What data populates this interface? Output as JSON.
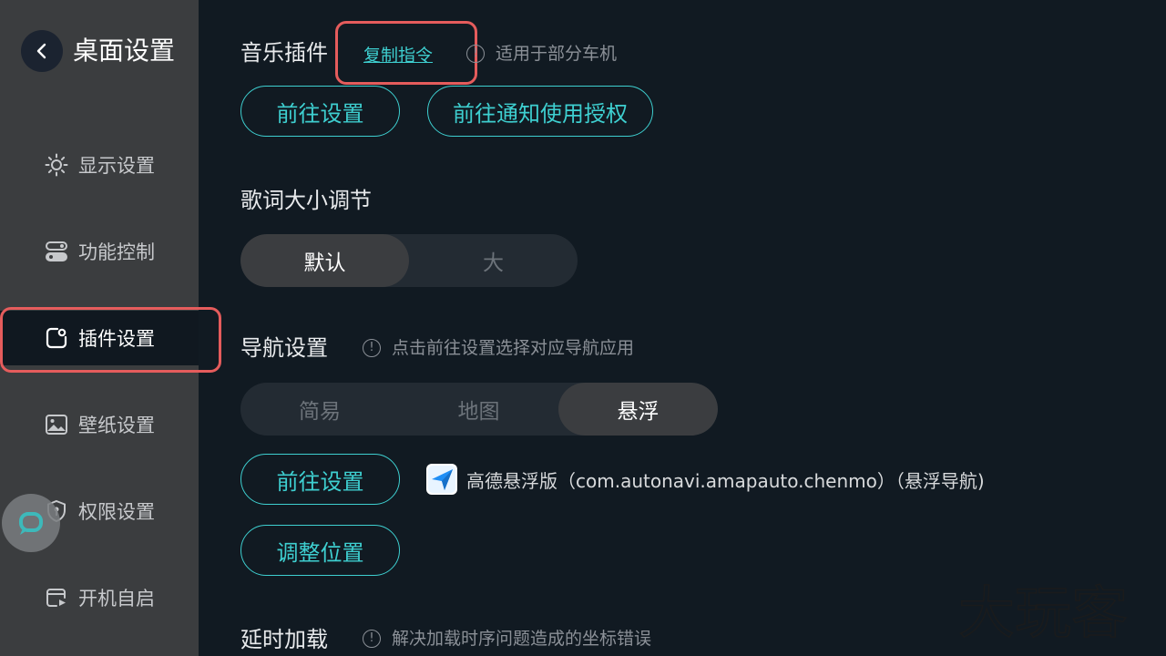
{
  "sidebar": {
    "title": "桌面设置",
    "items": [
      {
        "label": "显示设置",
        "icon": "sun-icon"
      },
      {
        "label": "功能控制",
        "icon": "toggle-icon"
      },
      {
        "label": "插件设置",
        "icon": "plugin-icon"
      },
      {
        "label": "壁纸设置",
        "icon": "image-icon"
      },
      {
        "label": "权限设置",
        "icon": "shield-icon"
      },
      {
        "label": "开机自启",
        "icon": "startup-icon"
      }
    ],
    "active_index": 2
  },
  "music_plugin": {
    "title": "音乐插件",
    "copy_link": "复制指令",
    "hint": "适用于部分车机",
    "buttons": [
      "前往设置",
      "前往通知使用授权"
    ]
  },
  "lyrics": {
    "title": "歌词大小调节",
    "options": [
      "默认",
      "大"
    ],
    "selected": "默认"
  },
  "navigation": {
    "title": "导航设置",
    "hint": "点击前往设置选择对应导航应用",
    "modes": [
      "简易",
      "地图",
      "悬浮"
    ],
    "selected": "悬浮",
    "goto_button": "前往设置",
    "adjust_button": "调整位置",
    "app_name": "高德悬浮版（com.autonavi.amapauto.chenmo）（悬浮导航)"
  },
  "delay_load": {
    "title": "延时加载",
    "hint": "解决加载时序问题造成的坐标错误"
  },
  "watermark_text": "大玩客",
  "colors": {
    "accent": "#3ecfd0",
    "highlight": "#e55c5c",
    "background": "#111a22",
    "sidebar": "#3b3d3f"
  }
}
